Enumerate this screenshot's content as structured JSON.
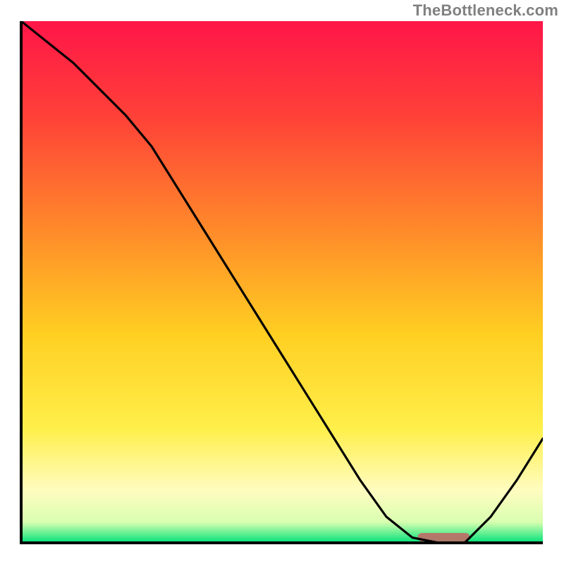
{
  "watermark_text": "TheBottleneck.com",
  "colors": {
    "gradient_top": "#ff1648",
    "gradient_upper_mid": "#ff6a2a",
    "gradient_mid": "#ffbf22",
    "gradient_lower_mid": "#ffef4a",
    "gradient_pale_yellow": "#fffcc0",
    "gradient_green": "#00e27a",
    "curve_stroke": "#000000",
    "min_mark_fill": "#c86464",
    "frame_stroke": "#000000",
    "background": "#ffffff"
  },
  "chart_data": {
    "type": "line",
    "title": "",
    "xlabel": "",
    "ylabel": "",
    "xlim": [
      0,
      100
    ],
    "ylim": [
      0,
      100
    ],
    "x": [
      0,
      5,
      10,
      15,
      20,
      25,
      30,
      35,
      40,
      45,
      50,
      55,
      60,
      65,
      70,
      75,
      80,
      85,
      90,
      95,
      100
    ],
    "values": [
      100,
      96,
      92,
      87,
      82,
      76,
      68,
      60,
      52,
      44,
      36,
      28,
      20,
      12,
      5,
      1,
      0,
      0,
      5,
      12,
      20
    ],
    "minimum_region_x": [
      76,
      86
    ],
    "grid": false,
    "legend": false
  }
}
